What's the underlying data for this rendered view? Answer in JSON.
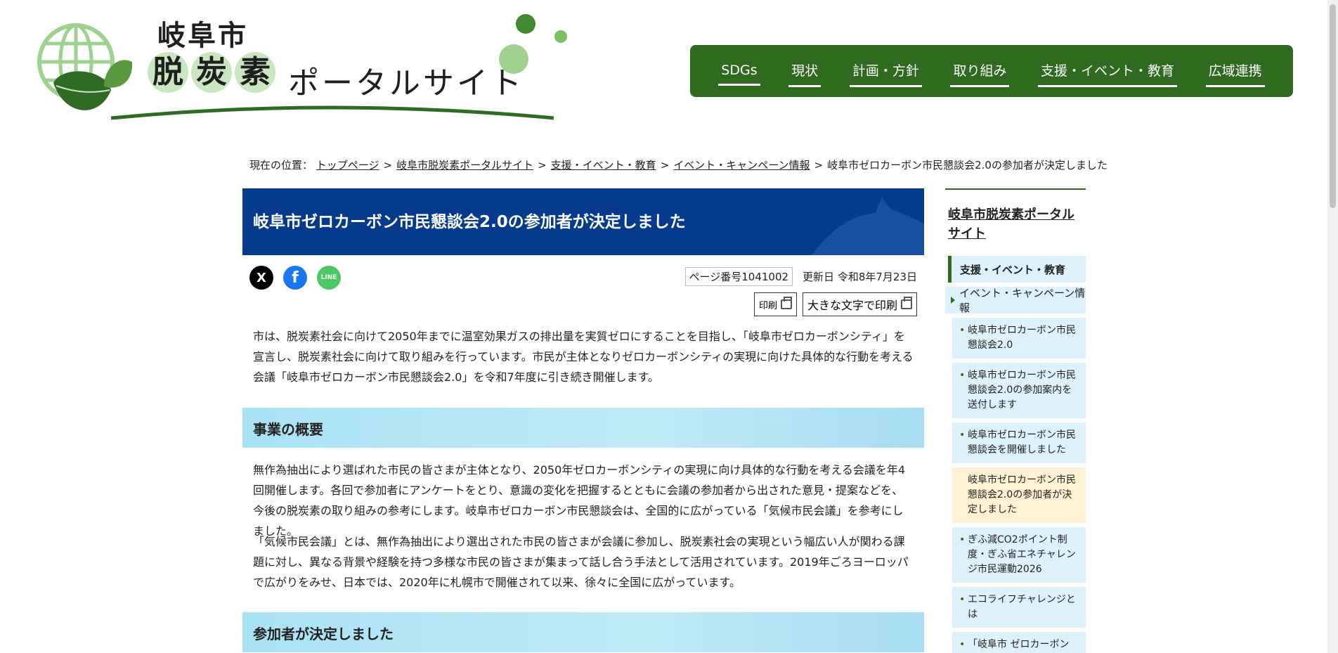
{
  "logo": {
    "city": "岐阜市",
    "chars": [
      "脱",
      "炭",
      "素"
    ],
    "portal": "ポータルサイト"
  },
  "gnav": [
    "SDGs",
    "現状",
    "計画・方針",
    "取り組み",
    "支援・イベント・教育",
    "広域連携"
  ],
  "breadcrumb": {
    "label": "現在の位置：",
    "links": [
      "トップページ",
      "岐阜市脱炭素ポータルサイト",
      "支援・イベント・教育",
      "イベント・キャンペーン情報"
    ],
    "current": "岐阜市ゼロカーボン市民懇談会2.0の参加者が決定しました",
    "separator": ">"
  },
  "page": {
    "title": "岐阜市ゼロカーボン市民懇談会2.0の参加者が決定しました",
    "page_number": "ページ番号1041002",
    "updated": "更新日 令和8年7月23日",
    "print": "印刷",
    "print_large": "大きな文字で印刷",
    "share": {
      "x": "X",
      "facebook": "f",
      "line": "LINE"
    },
    "intro": "市は、脱炭素社会に向けて2050年までに温室効果ガスの排出量を実質ゼロにすることを目指し、「岐阜市ゼロカーボンシティ」を宣言し、脱炭素社会に向けて取り組みを行っています。市民が主体となりゼロカーボンシティの実現に向けた具体的な行動を考える会議「岐阜市ゼロカーボン市民懇談会2.0」を令和7年度に引き続き開催します。",
    "section1_title": "事業の概要",
    "section1_p1": "無作為抽出により選ばれた市民の皆さまが主体となり、2050年ゼロカーボンシティの実現に向け具体的な行動を考える会議を年4回開催します。各回で参加者にアンケートをとり、意識の変化を把握するとともに会議の参加者から出された意見・提案などを、今後の脱炭素の取り組みの参考にします。岐阜市ゼロカーボン市民懇談会は、全国的に広がっている「気候市民会議」を参考にしました。",
    "section1_p2": "「気候市民会議」とは、無作為抽出により選出された市民の皆さまが会議に参加し、脱炭素社会の実現という幅広い人が関わる課題に対し、異なる背景や経験を持つ多様な市民の皆さまが集まって話し合う手法として活用されています。2019年ごろヨーロッパで広がりをみせ、日本では、2020年に札幌市で開催されて以来、徐々に全国に広がっています。",
    "section2_title": "参加者が決定しました"
  },
  "side": {
    "title": "岐阜市脱炭素ポータルサイト",
    "category": "支援・イベント・教育",
    "subcategory": "イベント・キャンペーン情報",
    "items": [
      "岐阜市ゼロカーボン市民懇談会2.0",
      "岐阜市ゼロカーボン市民懇談会2.0の参加案内を送付します",
      "岐阜市ゼロカーボン市民懇談会を開催しました",
      "岐阜市ゼロカーボン市民懇談会2.0の参加者が決定しました",
      "ぎふ減CO2ポイント制度・ぎふ省エネチャレンジ市民運動2026",
      "エコライフチャレンジとは",
      "「岐阜市 ゼロカーボンフ"
    ]
  }
}
